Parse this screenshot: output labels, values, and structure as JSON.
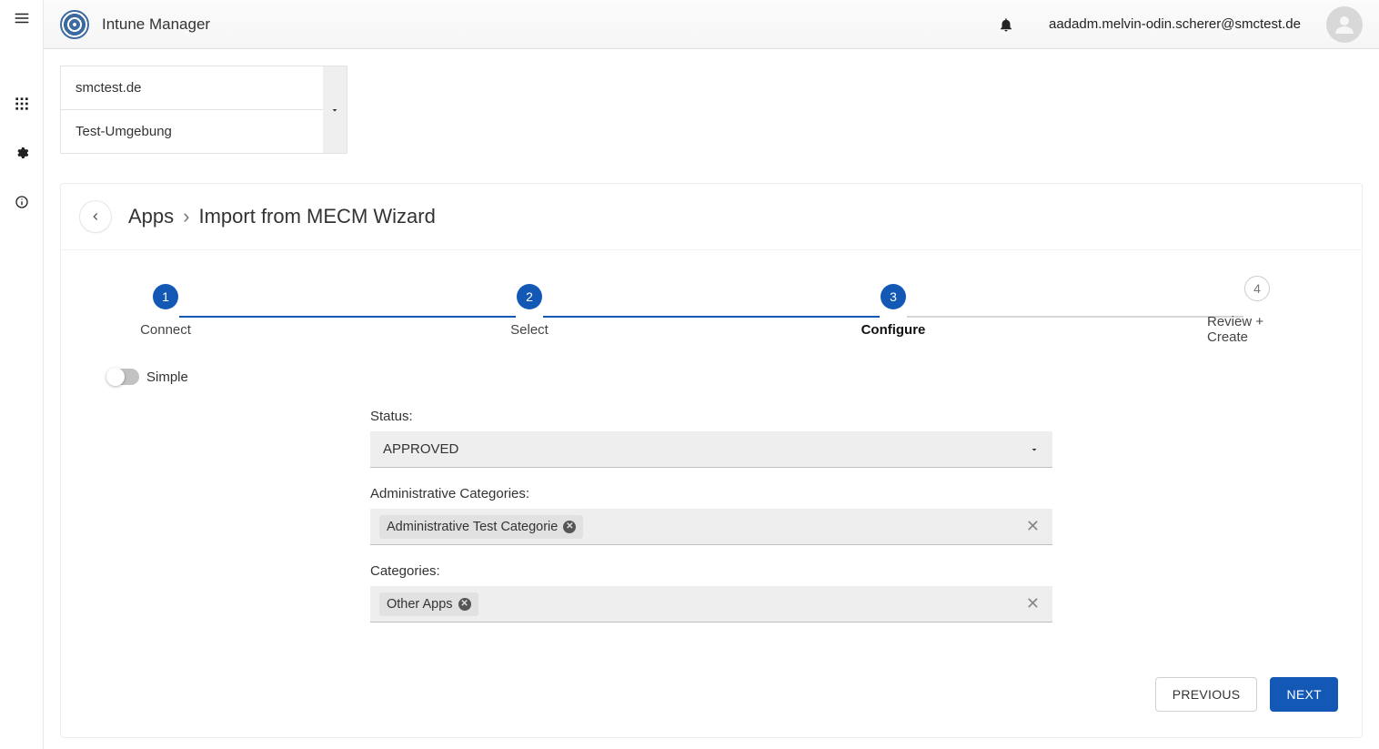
{
  "header": {
    "brand": "Intune Manager",
    "user_email": "aadadm.melvin-odin.scherer@smctest.de"
  },
  "tenant": {
    "line1": "smctest.de",
    "line2": "Test-Umgebung"
  },
  "breadcrumb": {
    "root": "Apps",
    "page": "Import from MECM Wizard"
  },
  "stepper": [
    {
      "num": "1",
      "label": "Connect",
      "done": true,
      "active": false
    },
    {
      "num": "2",
      "label": "Select",
      "done": true,
      "active": false
    },
    {
      "num": "3",
      "label": "Configure",
      "done": true,
      "active": true
    },
    {
      "num": "4",
      "label": "Review + Create",
      "done": false,
      "active": false
    }
  ],
  "toggle": {
    "label": "Simple"
  },
  "form": {
    "status": {
      "label": "Status:",
      "value": "APPROVED"
    },
    "admin_cats": {
      "label": "Administrative Categories:",
      "chip": "Administrative Test Categorie"
    },
    "categories": {
      "label": "Categories:",
      "chip": "Other Apps"
    }
  },
  "actions": {
    "previous": "PREVIOUS",
    "next": "NEXT"
  }
}
